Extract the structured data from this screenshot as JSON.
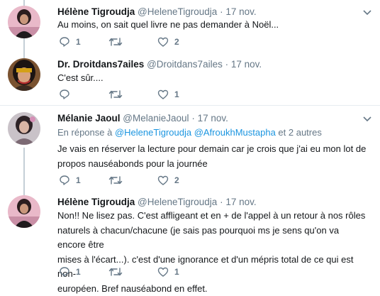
{
  "tweets": [
    {
      "name": "Hélène Tigroudja",
      "handle": "@HeleneTigroudja",
      "time": "· 17 nov.",
      "text": "Au moins, on sait quel livre ne pas demander à Noël...",
      "reply_count": "1",
      "retweet_count": "",
      "like_count": "2"
    },
    {
      "name": "Dr. Droitdans7ailes",
      "handle": "@Droitdans7ailes",
      "time": "· 17 nov.",
      "text": "C'est sûr....",
      "reply_count": "",
      "retweet_count": "",
      "like_count": "1"
    },
    {
      "name": "Mélanie Jaoul",
      "handle": "@MelanieJaoul",
      "time": "· 17 nov.",
      "reply_prefix": "En réponse à",
      "reply_user1": "@HeleneTigroudja",
      "reply_user2": "@AfroukhMustapha",
      "reply_suffix": "et 2 autres",
      "text_line1": "Je vais en réserver la lecture pour demain car je crois que j'ai eu mon lot de",
      "text_line2": "propos nauséabonds pour la journée",
      "reply_count": "1",
      "retweet_count": "",
      "like_count": "2"
    },
    {
      "name": "Hélène Tigroudja",
      "handle": "@HeleneTigroudja",
      "time": "· 17 nov.",
      "text_line1": "Non!! Ne lisez pas. C'est affligeant et en + de l'appel à un retour à nos rôles",
      "text_line2": "naturels à chacun/chacune (je sais pas pourquoi ms je sens qu'on va encore être",
      "text_line3": "mises à l'écart...). c'est d'une ignorance et d'un mépris total de ce qui est non-",
      "text_line4": "européen. Bref nauséabond en effet.",
      "reply_count": "1",
      "retweet_count": "",
      "like_count": "1"
    }
  ],
  "colors": {
    "link": "#1b95e0",
    "secondary": "#657786",
    "thread_line": "#c4cfd6",
    "divider": "#e6ecf0"
  },
  "icons": [
    "reply-icon",
    "retweet-icon",
    "like-icon",
    "chevron-down-icon"
  ]
}
